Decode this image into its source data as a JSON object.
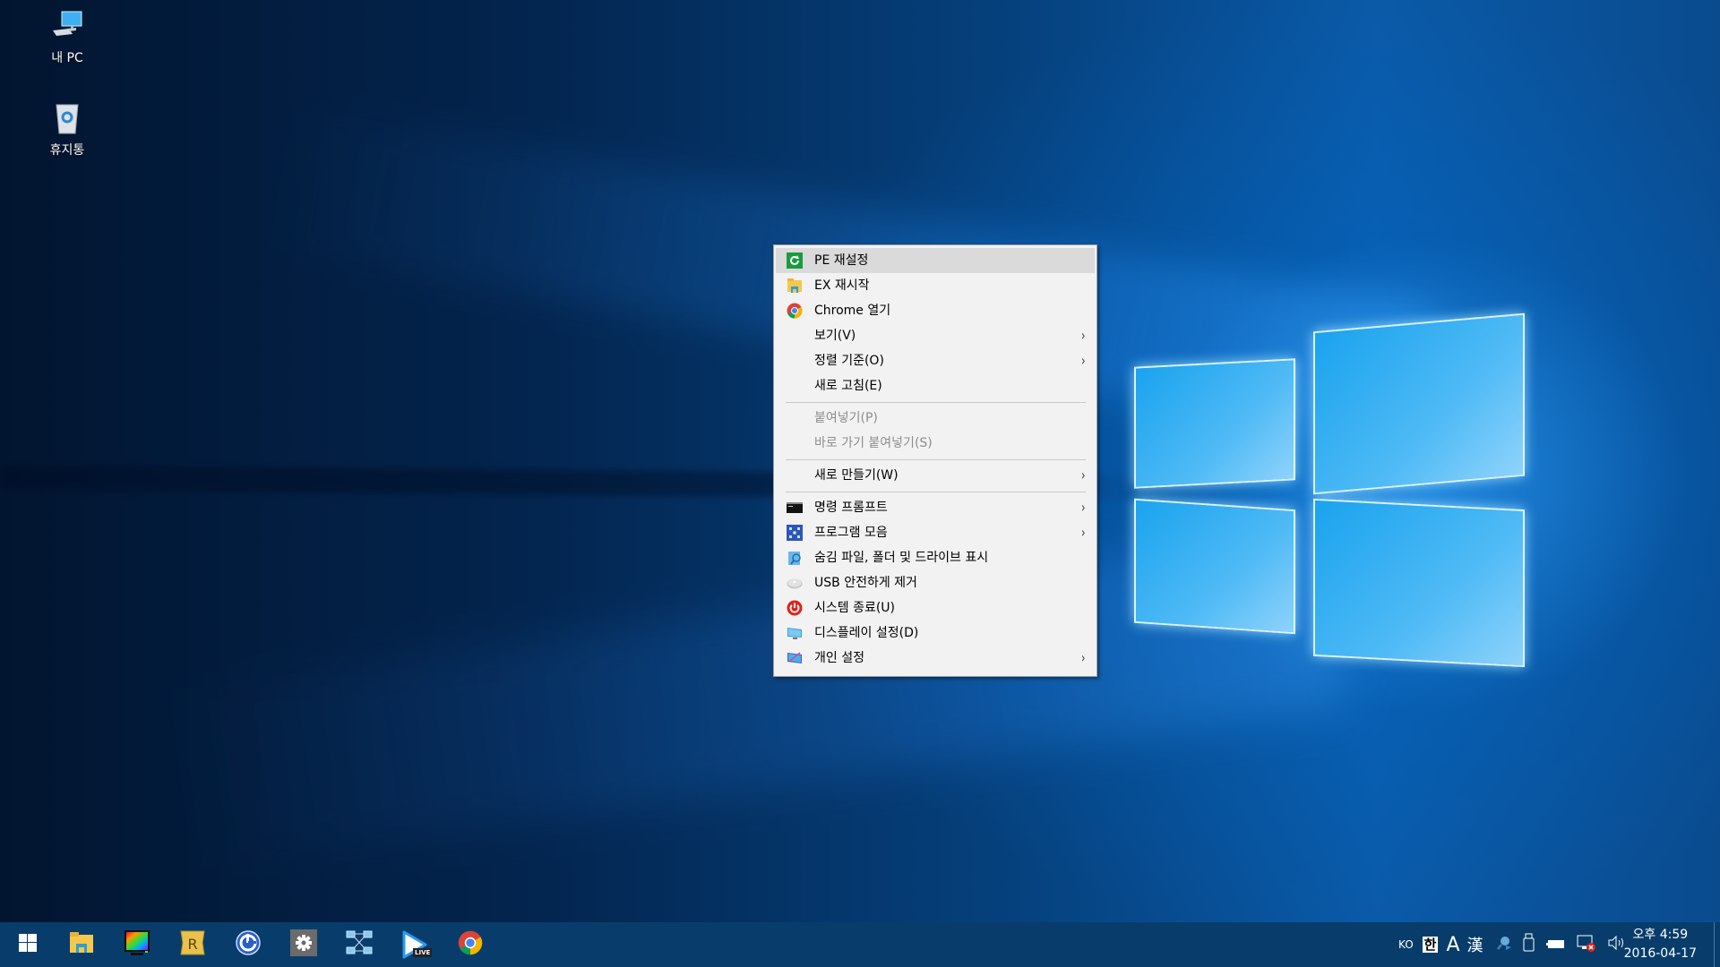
{
  "desktop": {
    "icons": [
      {
        "label": "내 PC",
        "icon": "this-pc-icon"
      },
      {
        "label": "휴지통",
        "icon": "recycle-bin-icon"
      }
    ]
  },
  "context_menu": {
    "groups": [
      [
        {
          "label": "PE 재설정",
          "icon": "refresh-green-icon",
          "highlighted": true,
          "submenu": false
        },
        {
          "label": "EX 재시작",
          "icon": "file-explorer-icon",
          "submenu": false
        },
        {
          "label": "Chrome 열기",
          "icon": "chrome-icon",
          "submenu": false
        },
        {
          "label": "보기(V)",
          "icon": null,
          "submenu": true
        },
        {
          "label": "정렬 기준(O)",
          "icon": null,
          "submenu": true
        },
        {
          "label": "새로 고침(E)",
          "icon": null,
          "submenu": false
        }
      ],
      [
        {
          "label": "붙여넣기(P)",
          "icon": null,
          "disabled": true,
          "submenu": false
        },
        {
          "label": "바로 가기 붙여넣기(S)",
          "icon": null,
          "disabled": true,
          "submenu": false
        }
      ],
      [
        {
          "label": "새로 만들기(W)",
          "icon": null,
          "submenu": true
        }
      ],
      [
        {
          "label": "명령 프롬프트",
          "icon": "command-prompt-icon",
          "submenu": true
        },
        {
          "label": "프로그램 모음",
          "icon": "program-collection-icon",
          "submenu": true
        },
        {
          "label": "숨김 파일, 폴더 및 드라이브 표시",
          "icon": "show-hidden-icon",
          "submenu": false
        },
        {
          "label": "USB 안전하게 제거",
          "icon": "usb-eject-icon",
          "submenu": false
        },
        {
          "label": "시스템 종료(U)",
          "icon": "power-icon",
          "submenu": false
        },
        {
          "label": "디스플레이 설정(D)",
          "icon": "display-icon",
          "submenu": false
        },
        {
          "label": "개인 설정",
          "icon": "personalize-icon",
          "submenu": true
        }
      ]
    ],
    "submenu_arrow": "›"
  },
  "taskbar": {
    "pinned": [
      {
        "name": "start-button",
        "icon": "windows-logo-icon"
      },
      {
        "name": "file-explorer",
        "icon": "file-explorer-icon"
      },
      {
        "name": "color-monitor-app",
        "icon": "color-monitor-icon"
      },
      {
        "name": "r-app",
        "icon": "r-app-icon",
        "glyph": "R"
      },
      {
        "name": "blue-circle-app",
        "icon": "blue-circle-app-icon"
      },
      {
        "name": "settings-app",
        "icon": "gear-icon"
      },
      {
        "name": "network-app",
        "icon": "network-topology-icon"
      },
      {
        "name": "live-player",
        "icon": "play-live-icon",
        "badge": "LIVE"
      },
      {
        "name": "chrome",
        "icon": "chrome-icon"
      }
    ],
    "tray": {
      "language": "KO",
      "ime_mode": "한",
      "ime_width": "A",
      "hanja": "漢",
      "icons": [
        "search-tray-icon",
        "usb-tray-icon",
        "battery-icon",
        "network-disconnected-icon",
        "volume-icon"
      ]
    },
    "clock": {
      "time": "오후 4:59",
      "date": "2016-04-17"
    }
  },
  "colors": {
    "taskbar_bg": "#083d6b",
    "menu_bg": "#f2f2f2",
    "menu_highlight": "#dadada",
    "disabled_text": "#8d8d8d"
  }
}
